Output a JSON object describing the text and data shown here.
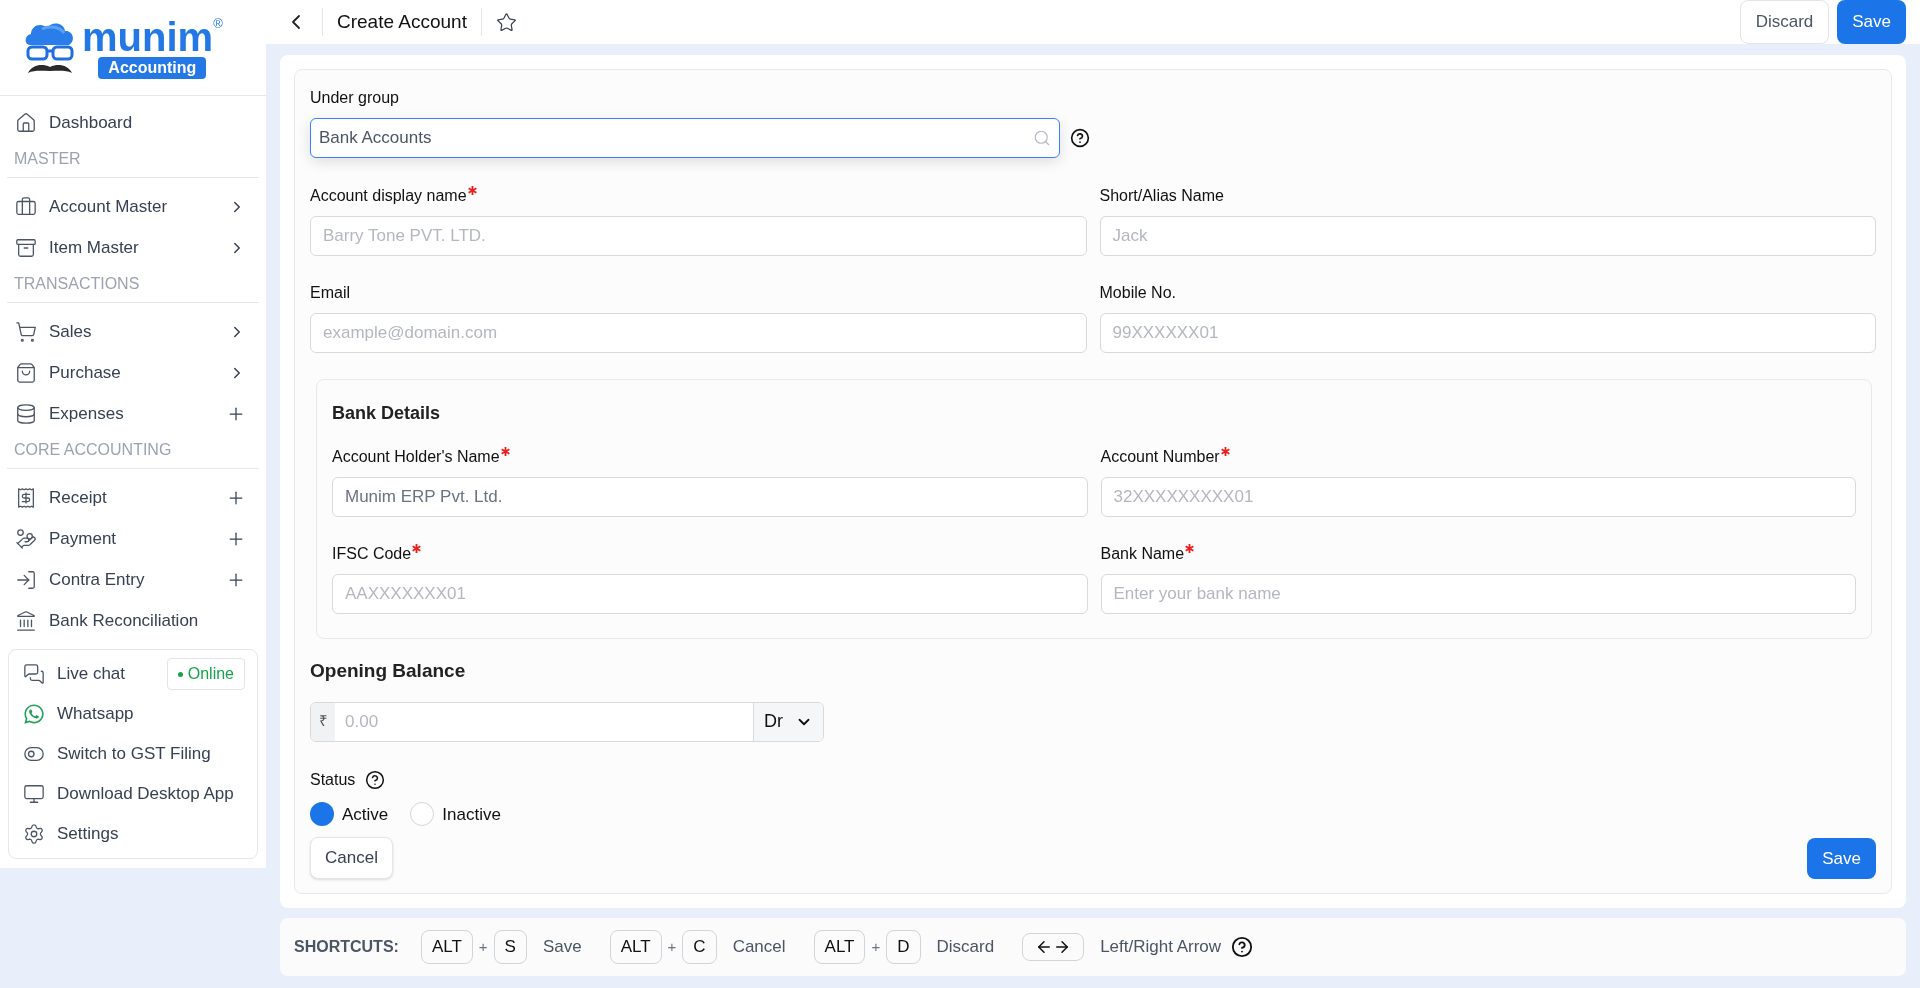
{
  "logo": {
    "name": "munim",
    "mark": "®",
    "tagline": "Accounting"
  },
  "sidebar": [
    {
      "kind": "item",
      "label": "Dashboard",
      "submenu": false,
      "addable": false
    },
    {
      "kind": "section",
      "label": "MASTER"
    },
    {
      "kind": "item",
      "label": "Account Master",
      "submenu": true,
      "addable": false
    },
    {
      "kind": "item",
      "label": "Item Master",
      "submenu": true,
      "addable": false
    },
    {
      "kind": "section",
      "label": "TRANSACTIONS"
    },
    {
      "kind": "item",
      "label": "Sales",
      "submenu": true,
      "addable": false
    },
    {
      "kind": "item",
      "label": "Purchase",
      "submenu": true,
      "addable": false
    },
    {
      "kind": "item",
      "label": "Expenses",
      "submenu": false,
      "addable": true
    },
    {
      "kind": "section",
      "label": "CORE ACCOUNTING"
    },
    {
      "kind": "item",
      "label": "Receipt",
      "submenu": false,
      "addable": true
    },
    {
      "kind": "item",
      "label": "Payment",
      "submenu": false,
      "addable": true
    },
    {
      "kind": "item",
      "label": "Contra Entry",
      "submenu": false,
      "addable": true
    },
    {
      "kind": "item",
      "label": "Bank Reconciliation",
      "submenu": false,
      "addable": false
    }
  ],
  "support": [
    {
      "label": "Live chat",
      "badge": "Online"
    },
    {
      "label": "Whatsapp"
    },
    {
      "label": "Switch to GST Filing"
    },
    {
      "label": "Download Desktop App"
    },
    {
      "label": "Settings"
    }
  ],
  "header": {
    "title": "Create Account",
    "buttons": [
      {
        "label": "Discard",
        "kind": "secondary"
      },
      {
        "label": "Save",
        "kind": "primary"
      }
    ]
  },
  "form": {
    "under_group": {
      "label": "Under group",
      "value": "Bank Accounts",
      "focused": true
    },
    "fields": [
      {
        "label": "Account display name",
        "required": true,
        "placeholder": "Barry Tone PVT. LTD."
      },
      {
        "label": "Short/Alias Name",
        "required": false,
        "placeholder": "Jack"
      },
      {
        "label": "Email",
        "required": false,
        "placeholder": "example@domain.com"
      },
      {
        "label": "Mobile No.",
        "required": false,
        "placeholder": "99XXXXXX01"
      }
    ],
    "bank_details": {
      "title": "Bank Details",
      "fields": [
        {
          "label": "Account Holder's Name",
          "required": true,
          "value": "Munim ERP Pvt. Ltd."
        },
        {
          "label": "Account Number",
          "required": true,
          "placeholder": "32XXXXXXXXX01"
        },
        {
          "label": "IFSC Code",
          "required": true,
          "placeholder": "AAXXXXXXX01"
        },
        {
          "label": "Bank Name",
          "required": true,
          "placeholder": "Enter your bank name"
        }
      ]
    },
    "opening_balance": {
      "title": "Opening Balance",
      "currency": "₹",
      "placeholder": "0.00",
      "type": "Dr"
    },
    "status": {
      "label": "Status",
      "options": [
        {
          "label": "Active",
          "selected": true
        },
        {
          "label": "Inactive",
          "selected": false
        }
      ]
    },
    "cancel": "Cancel",
    "save": "Save"
  },
  "shortcuts": {
    "label": "SHORTCUTS:",
    "joiner": "+",
    "items": [
      {
        "kind": "combo",
        "keys": [
          "ALT",
          "S"
        ],
        "action": "Save"
      },
      {
        "kind": "combo",
        "keys": [
          "ALT",
          "C"
        ],
        "action": "Cancel"
      },
      {
        "kind": "combo",
        "keys": [
          "ALT",
          "D"
        ],
        "action": "Discard"
      },
      {
        "kind": "arrows",
        "action": "Left/Right Arrow"
      }
    ]
  }
}
